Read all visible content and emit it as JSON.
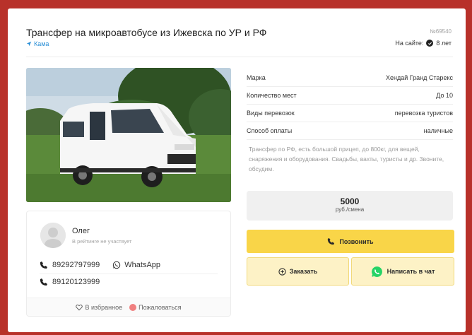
{
  "listing": {
    "title": "Трансфер на микроавтобусе из Ижевска по УР и РФ",
    "city": "Кама",
    "id": "№69540",
    "on_site_label": "На сайте:",
    "on_site_value": "8 лет"
  },
  "specs": [
    {
      "label": "Марка",
      "value": "Хендай Гранд Старекс"
    },
    {
      "label": "Количество мест",
      "value": "До 10"
    },
    {
      "label": "Виды перевозок",
      "value": "перевозка туристов"
    },
    {
      "label": "Способ оплаты",
      "value": "наличные"
    }
  ],
  "description": "Трансфер по РФ, есть большой прицеп, до 800кг, для вещей, снаряжения и оборудования. Свадьбы, вахты, туристы и др. Звоните, обсудим.",
  "price": {
    "value": "5000",
    "unit": "руб./смена"
  },
  "actions": {
    "call_label": "Позвонить",
    "order_label": "Заказать",
    "chat_label": "Написать в чат"
  },
  "contact": {
    "name": "Олег",
    "rating_note": "В рейтинге не участвует",
    "phone1": "89292797999",
    "whatsapp_label": "WhatsApp",
    "phone2": "89120123999",
    "favorite_label": "В избранное",
    "report_label": "Пожаловаться"
  },
  "colors": {
    "accent_yellow": "#f9d548",
    "link_blue": "#2b8fd6",
    "whatsapp_green": "#25d366",
    "frame_red": "#b8312a"
  },
  "icons": [
    "location-arrow-icon",
    "check-badge-icon",
    "phone-icon",
    "whatsapp-icon",
    "plus-circle-icon",
    "heart-icon",
    "report-icon"
  ]
}
